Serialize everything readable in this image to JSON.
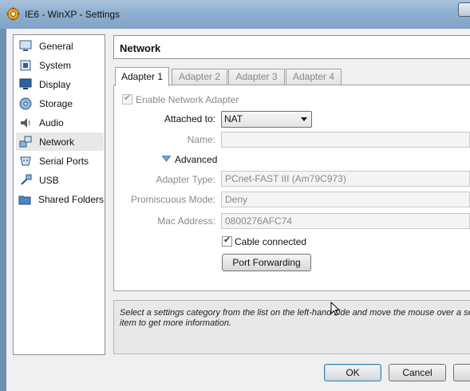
{
  "window": {
    "title": "IE6 - WinXP - Settings"
  },
  "sidebar": {
    "items": [
      {
        "label": "General",
        "icon": "monitor-icon"
      },
      {
        "label": "System",
        "icon": "chip-icon"
      },
      {
        "label": "Display",
        "icon": "display-icon"
      },
      {
        "label": "Storage",
        "icon": "disk-icon"
      },
      {
        "label": "Audio",
        "icon": "speaker-icon"
      },
      {
        "label": "Network",
        "icon": "network-icon",
        "selected": true
      },
      {
        "label": "Serial Ports",
        "icon": "serial-port-icon"
      },
      {
        "label": "USB",
        "icon": "usb-icon"
      },
      {
        "label": "Shared Folders",
        "icon": "folder-icon"
      }
    ]
  },
  "main": {
    "title": "Network",
    "tabs": [
      {
        "label": "Adapter 1",
        "active": true
      },
      {
        "label": "Adapter 2"
      },
      {
        "label": "Adapter 3"
      },
      {
        "label": "Adapter 4"
      }
    ],
    "adapter": {
      "enable_label": "Enable Network Adapter",
      "enable_checked": true,
      "attached_to_label": "Attached to:",
      "attached_to_value": "NAT",
      "name_label": "Name:",
      "name_value": "",
      "advanced_label": "Advanced",
      "adapter_type_label": "Adapter Type:",
      "adapter_type_value": "PCnet-FAST III (Am79C973)",
      "promiscuous_label": "Promiscuous Mode:",
      "promiscuous_value": "Deny",
      "mac_label": "Mac Address:",
      "mac_value": "0800276AFC74",
      "cable_label": "Cable connected",
      "cable_checked": true,
      "port_forwarding_label": "Port Forwarding"
    },
    "info_text": "Select a settings category from the list on the left-hand side and move the mouse over a se item to get more information."
  },
  "footer": {
    "ok_label": "OK",
    "cancel_label": "Cancel"
  },
  "colors": {
    "selection": "#e8e8e8",
    "default_button_border": "#3c7fb1",
    "title_bar": "#8fb0d0"
  }
}
